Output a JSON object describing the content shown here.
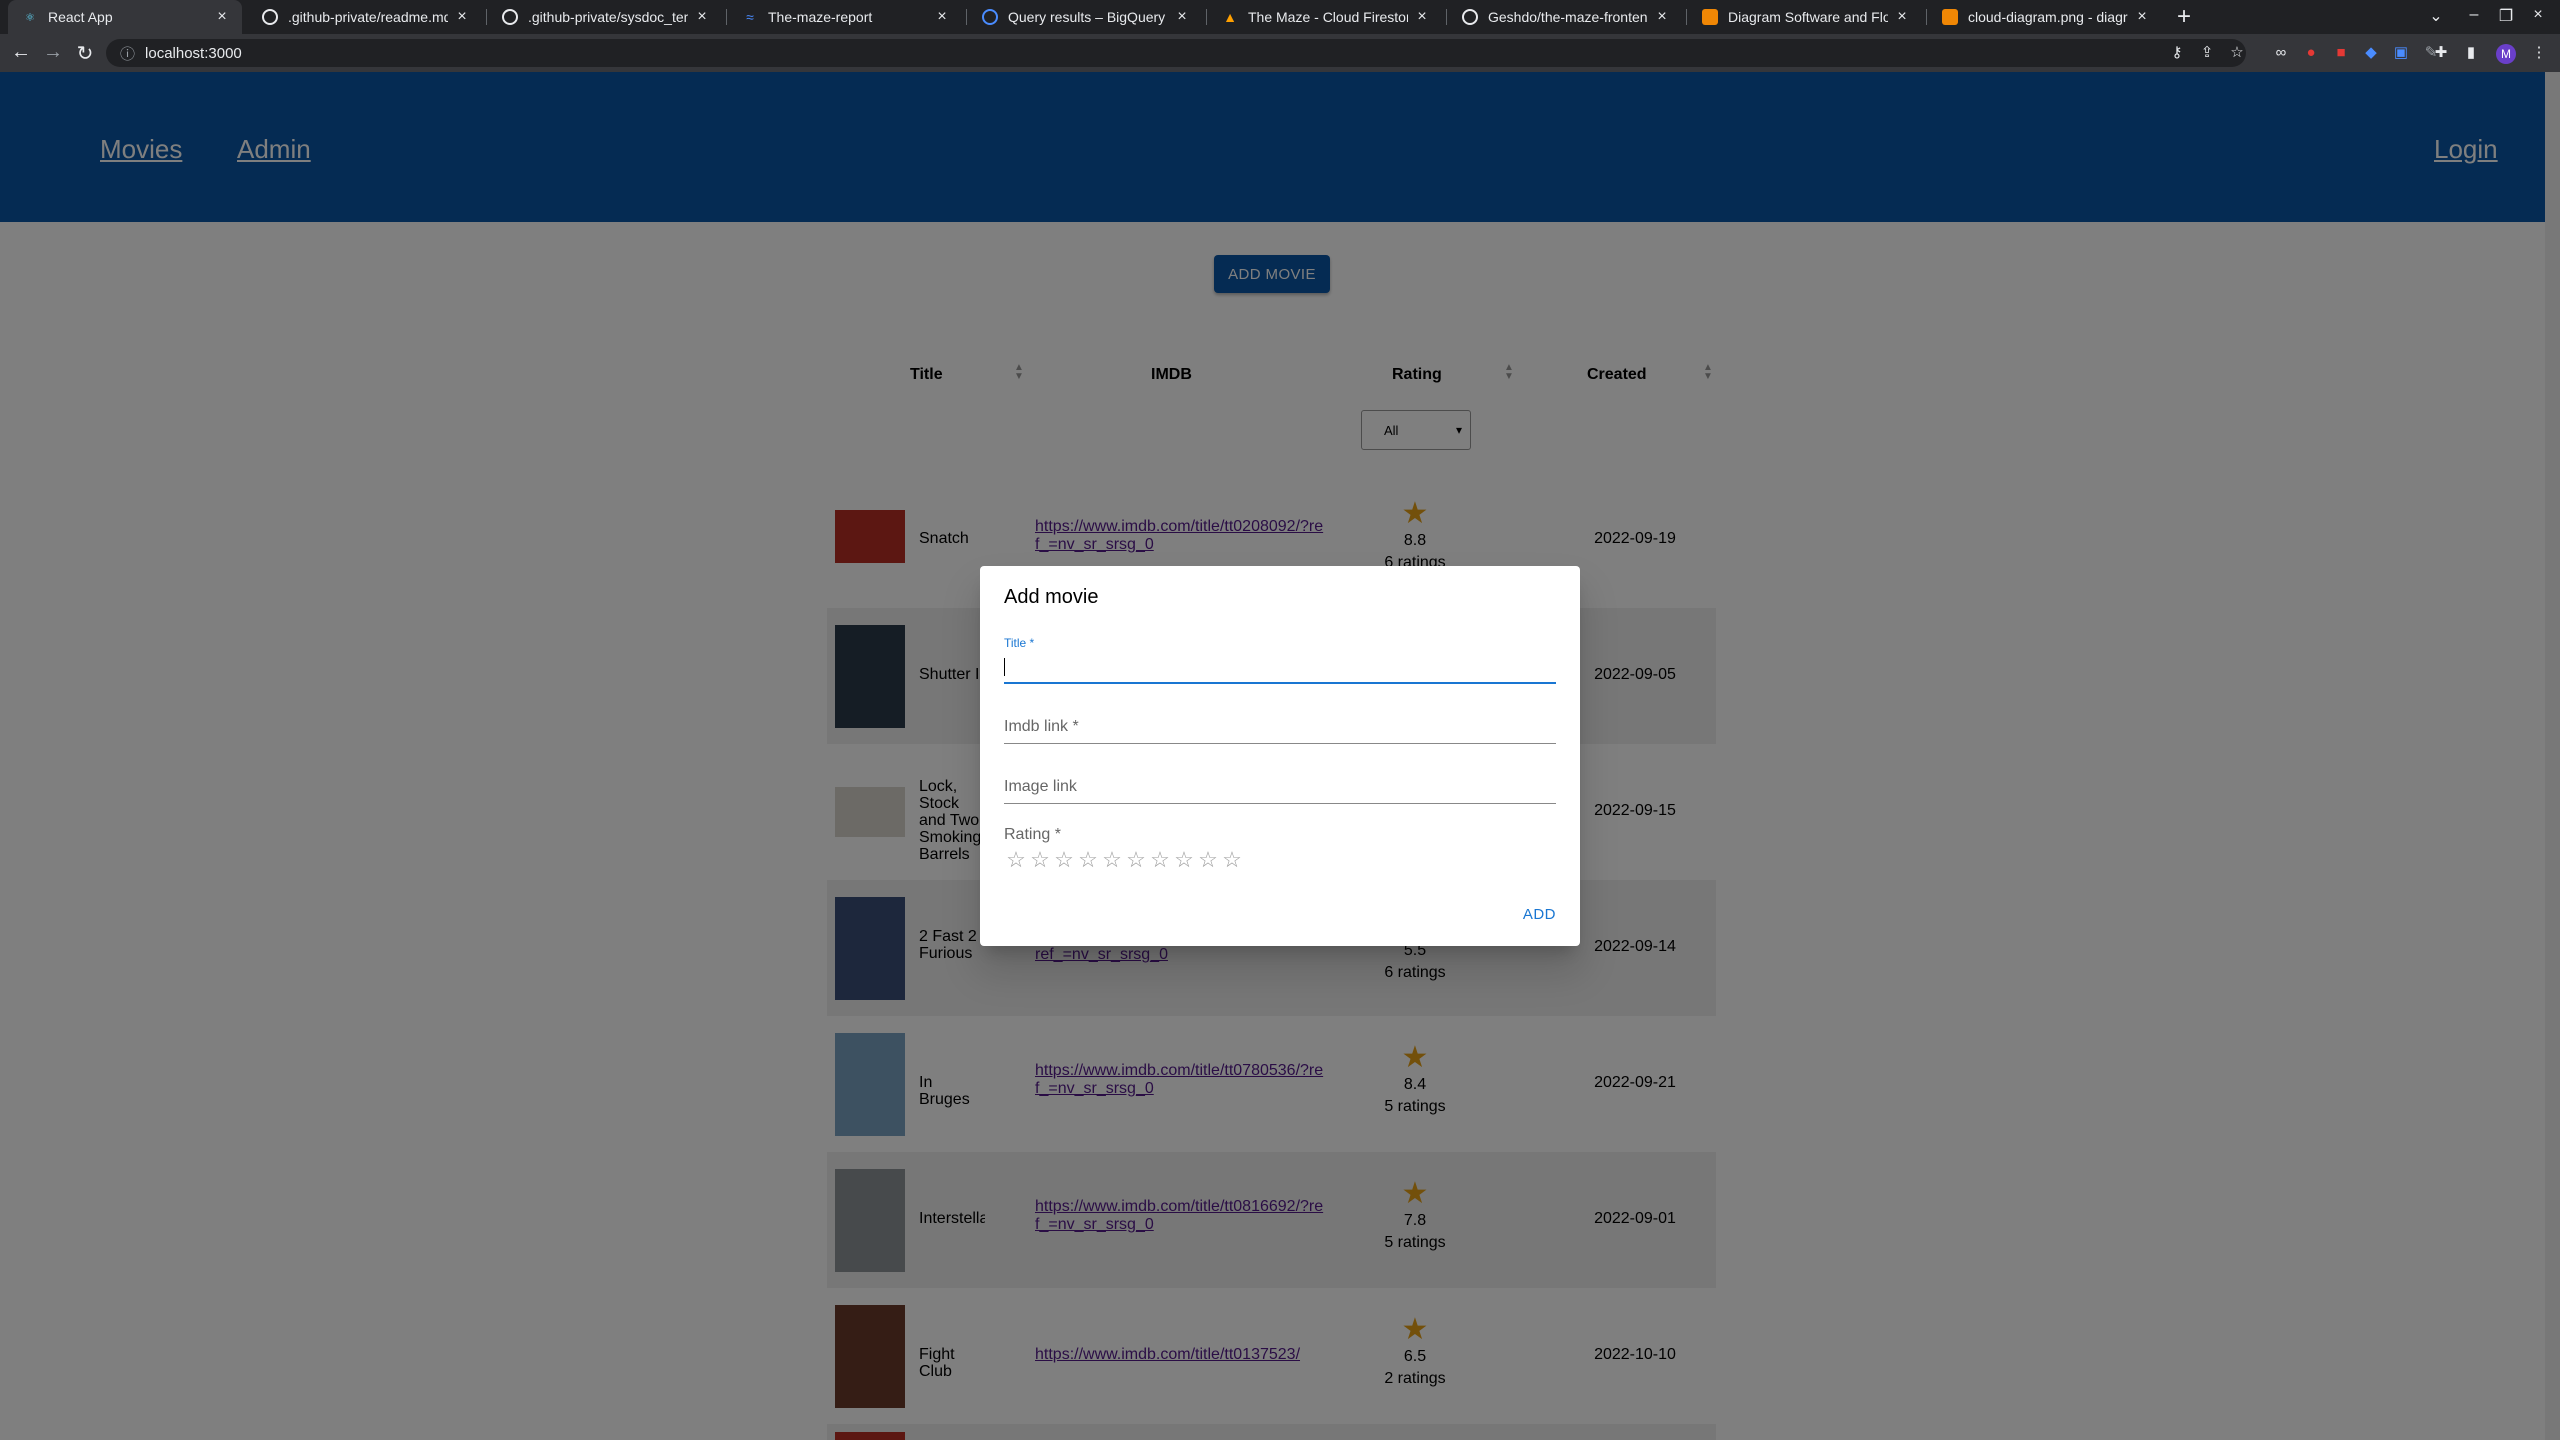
{
  "browser": {
    "tabs": [
      {
        "title": "React App",
        "favicon_color": "#61dafb",
        "active": true
      },
      {
        "title": ".github-private/readme.md a",
        "favicon_color": "#e8eaed"
      },
      {
        "title": ".github-private/sysdoc_temp",
        "favicon_color": "#e8eaed"
      },
      {
        "title": "The-maze-report",
        "favicon_color": "#4a8cff"
      },
      {
        "title": "Query results – BigQuery – Th",
        "favicon_color": "#4a8cff"
      },
      {
        "title": "The Maze - Cloud Firestore - F",
        "favicon_color": "#ffa000"
      },
      {
        "title": "Geshdo/the-maze-frontend-",
        "favicon_color": "#e8eaed"
      },
      {
        "title": "Diagram Software and Flowc",
        "favicon_color": "#f08705"
      },
      {
        "title": "cloud-diagram.png - diagram",
        "favicon_color": "#f08705"
      }
    ],
    "url": "localhost:3000"
  },
  "nav": {
    "movies": "Movies",
    "admin": "Admin",
    "login": "Login"
  },
  "actions": {
    "add_movie": "ADD MOVIE"
  },
  "table": {
    "headers": {
      "title": "Title",
      "imdb": "IMDB",
      "rating": "Rating",
      "created": "Created"
    },
    "filter_value": "All",
    "rows": [
      {
        "title": "Snatch",
        "imdb": "https://www.imdb.com/title/tt0208092/?ref_=nv_sr_srsg_0",
        "rating": "8.8",
        "ratings_count": "6 ratings",
        "created": "2022-09-19",
        "poster_color": "#b82f25"
      },
      {
        "title": "Shutter I",
        "imdb": "",
        "rating": "",
        "ratings_count": "",
        "created": "2022-09-05",
        "poster_color": "#2a3a4a"
      },
      {
        "title": "Lock, Stock and Two Smoking Barrels",
        "imdb": "",
        "rating": "",
        "ratings_count": "",
        "created": "2022-09-15",
        "poster_color": "#d8d5cc"
      },
      {
        "title": "2 Fast 2 Furious",
        "imdb": "ref_=nv_sr_srsg_0",
        "rating": "5.5",
        "ratings_count": "6 ratings",
        "created": "2022-09-14",
        "poster_color": "#3a4f78"
      },
      {
        "title": "In Bruges",
        "imdb": "https://www.imdb.com/title/tt0780536/?ref_=nv_sr_srsg_0",
        "rating": "8.4",
        "ratings_count": "5 ratings",
        "created": "2022-09-21",
        "poster_color": "#7aa2c2"
      },
      {
        "title": "Interstellar",
        "imdb": "https://www.imdb.com/title/tt0816692/?ref_=nv_sr_srsg_0",
        "rating": "7.8",
        "ratings_count": "5 ratings",
        "created": "2022-09-01",
        "poster_color": "#8f9499"
      },
      {
        "title": "Fight Club",
        "imdb": "https://www.imdb.com/title/tt0137523/",
        "rating": "6.5",
        "ratings_count": "2 ratings",
        "created": "2022-10-10",
        "poster_color": "#6a3a2a"
      }
    ]
  },
  "dialog": {
    "title": "Add movie",
    "fields": {
      "title_label": "Title *",
      "imdb_label": "Imdb link *",
      "image_label": "Image link",
      "rating_label": "Rating *"
    },
    "star_count": 10,
    "add_button": "ADD"
  },
  "colors": {
    "appbar": "#0b57a6",
    "accent": "#1976d2",
    "star": "#e6a116"
  }
}
